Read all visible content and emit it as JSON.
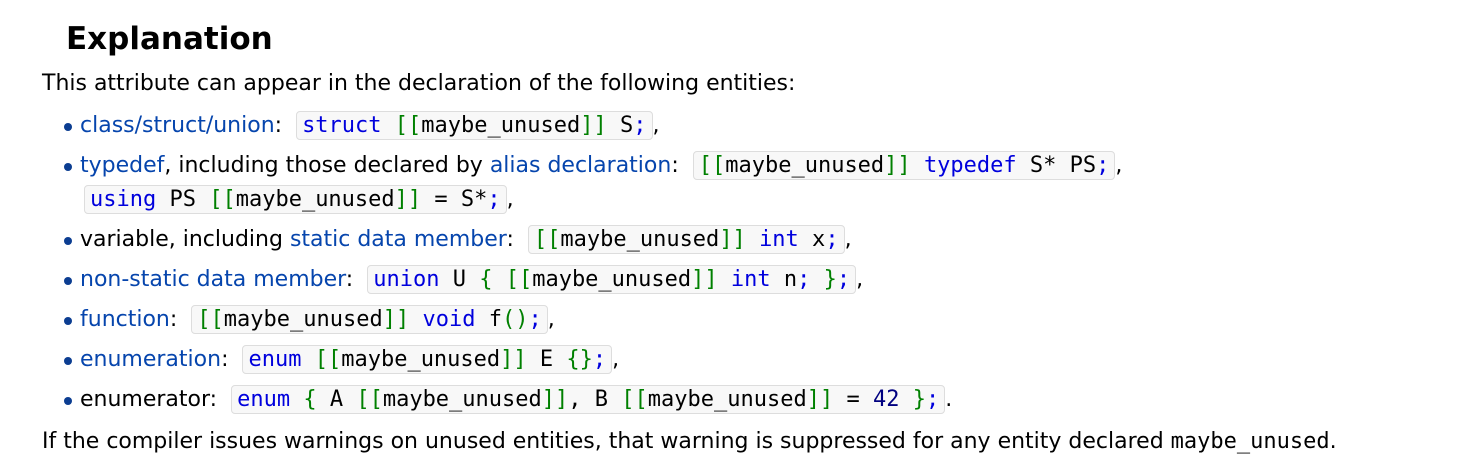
{
  "heading": "Explanation",
  "intro": "This attribute can appear in the declaration of the following entities:",
  "items": [
    {
      "link": "class/struct/union",
      "sep": ":",
      "code": [
        [
          "kw",
          "struct"
        ],
        [
          "pl",
          " "
        ],
        [
          "br",
          "[["
        ],
        [
          "pl",
          "maybe_unused"
        ],
        [
          "br",
          "]]"
        ],
        [
          "pl",
          " S"
        ],
        [
          "kw",
          ";"
        ]
      ],
      "tail": ","
    },
    {
      "link": "typedef",
      "mid": ", including those declared by ",
      "link2": "alias declaration",
      "sep": ":",
      "code": [
        [
          "br",
          "[["
        ],
        [
          "pl",
          "maybe_unused"
        ],
        [
          "br",
          "]]"
        ],
        [
          "pl",
          " "
        ],
        [
          "kw",
          "typedef"
        ],
        [
          "pl",
          " S* PS"
        ],
        [
          "kw",
          ";"
        ]
      ],
      "tail": ",",
      "code2": [
        [
          "kw",
          "using"
        ],
        [
          "pl",
          " PS "
        ],
        [
          "br",
          "[["
        ],
        [
          "pl",
          "maybe_unused"
        ],
        [
          "br",
          "]]"
        ],
        [
          "pl",
          " = S*"
        ],
        [
          "kw",
          ";"
        ]
      ],
      "tail2": ","
    },
    {
      "text": "variable, including ",
      "link": "static data member",
      "sep": ":",
      "code": [
        [
          "br",
          "[["
        ],
        [
          "pl",
          "maybe_unused"
        ],
        [
          "br",
          "]]"
        ],
        [
          "pl",
          " "
        ],
        [
          "kw",
          "int"
        ],
        [
          "pl",
          " x"
        ],
        [
          "kw",
          ";"
        ]
      ],
      "tail": ","
    },
    {
      "link": "non-static data member",
      "sep": ":",
      "code": [
        [
          "kw",
          "union"
        ],
        [
          "pl",
          " U "
        ],
        [
          "br",
          "{"
        ],
        [
          "pl",
          " "
        ],
        [
          "br",
          "[["
        ],
        [
          "pl",
          "maybe_unused"
        ],
        [
          "br",
          "]]"
        ],
        [
          "pl",
          " "
        ],
        [
          "kw",
          "int"
        ],
        [
          "pl",
          " n"
        ],
        [
          "kw",
          ";"
        ],
        [
          "pl",
          " "
        ],
        [
          "br",
          "}"
        ],
        [
          "kw",
          ";"
        ]
      ],
      "tail": ","
    },
    {
      "link": "function",
      "sep": ":",
      "code": [
        [
          "br",
          "[["
        ],
        [
          "pl",
          "maybe_unused"
        ],
        [
          "br",
          "]]"
        ],
        [
          "pl",
          " "
        ],
        [
          "kw",
          "void"
        ],
        [
          "pl",
          " f"
        ],
        [
          "br",
          "()"
        ],
        [
          "kw",
          ";"
        ]
      ],
      "tail": ","
    },
    {
      "link": "enumeration",
      "sep": ":",
      "code": [
        [
          "kw",
          "enum"
        ],
        [
          "pl",
          " "
        ],
        [
          "br",
          "[["
        ],
        [
          "pl",
          "maybe_unused"
        ],
        [
          "br",
          "]]"
        ],
        [
          "pl",
          " E "
        ],
        [
          "br",
          "{}"
        ],
        [
          "kw",
          ";"
        ]
      ],
      "tail": ","
    },
    {
      "text": "enumerator",
      "sep": ":",
      "code": [
        [
          "kw",
          "enum"
        ],
        [
          "pl",
          " "
        ],
        [
          "br",
          "{"
        ],
        [
          "pl",
          " A "
        ],
        [
          "br",
          "[["
        ],
        [
          "pl",
          "maybe_unused"
        ],
        [
          "br",
          "]]"
        ],
        [
          "pl",
          ", B "
        ],
        [
          "br",
          "[["
        ],
        [
          "pl",
          "maybe_unused"
        ],
        [
          "br",
          "]]"
        ],
        [
          "pl",
          " = "
        ],
        [
          "num",
          "42"
        ],
        [
          "pl",
          " "
        ],
        [
          "br",
          "}"
        ],
        [
          "kw",
          ";"
        ]
      ],
      "tail": "."
    }
  ],
  "outro_text": "If the compiler issues warnings on unused entities, that warning is suppressed for any entity declared ",
  "outro_code": "maybe_unused",
  "outro_end": ".",
  "colors": {
    "link": "#0645ad",
    "keyword": "#0000dd",
    "bracket": "#008000",
    "number": "#000080"
  }
}
